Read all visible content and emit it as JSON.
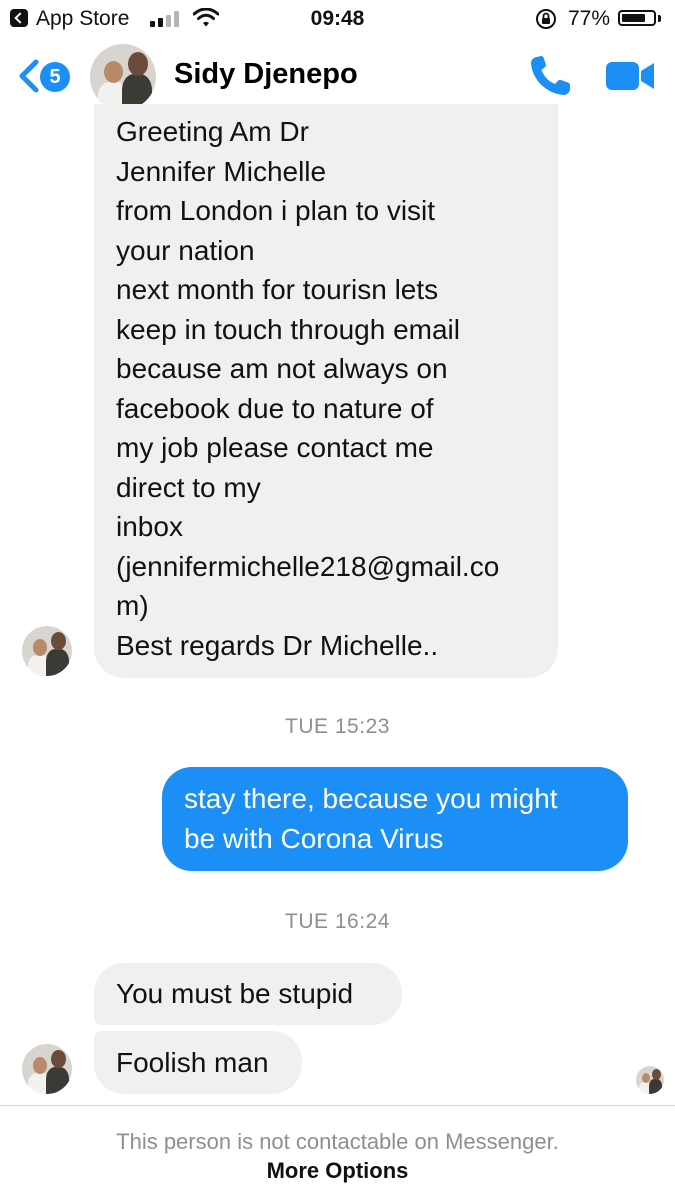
{
  "status_bar": {
    "back_app": "App Store",
    "time": "09:48",
    "battery_percent": "77%",
    "battery_level": 0.77,
    "signal_bars_filled": 2,
    "signal_bars_total": 4
  },
  "header": {
    "unread_count": "5",
    "contact_name": "Sidy Djenepo",
    "accent_color": "#1b8ff5",
    "call_icon": "phone-icon",
    "video_icon": "video-camera-icon"
  },
  "messages": {
    "incoming_1_lines": [
      "Greeting Am Dr",
      "Jennifer  Michelle",
      "from London i plan to visit",
      "your nation",
      "next month for tourisn lets",
      "keep in touch through email",
      "because am not always on",
      "facebook due to nature of",
      "my job please contact me",
      "direct to my",
      "inbox",
      "(jennifermichelle218@gmail.co",
      "m)",
      "Best regards Dr Michelle.."
    ],
    "timestamp_1": "TUE 15:23",
    "outgoing_1_lines": [
      "stay there, because you might",
      "be with Corona Virus"
    ],
    "timestamp_2": "TUE 16:24",
    "incoming_2": "You must be stupid",
    "incoming_3": "Foolish man"
  },
  "footer": {
    "notice": "This person is not contactable on Messenger.",
    "more_options": "More Options"
  }
}
